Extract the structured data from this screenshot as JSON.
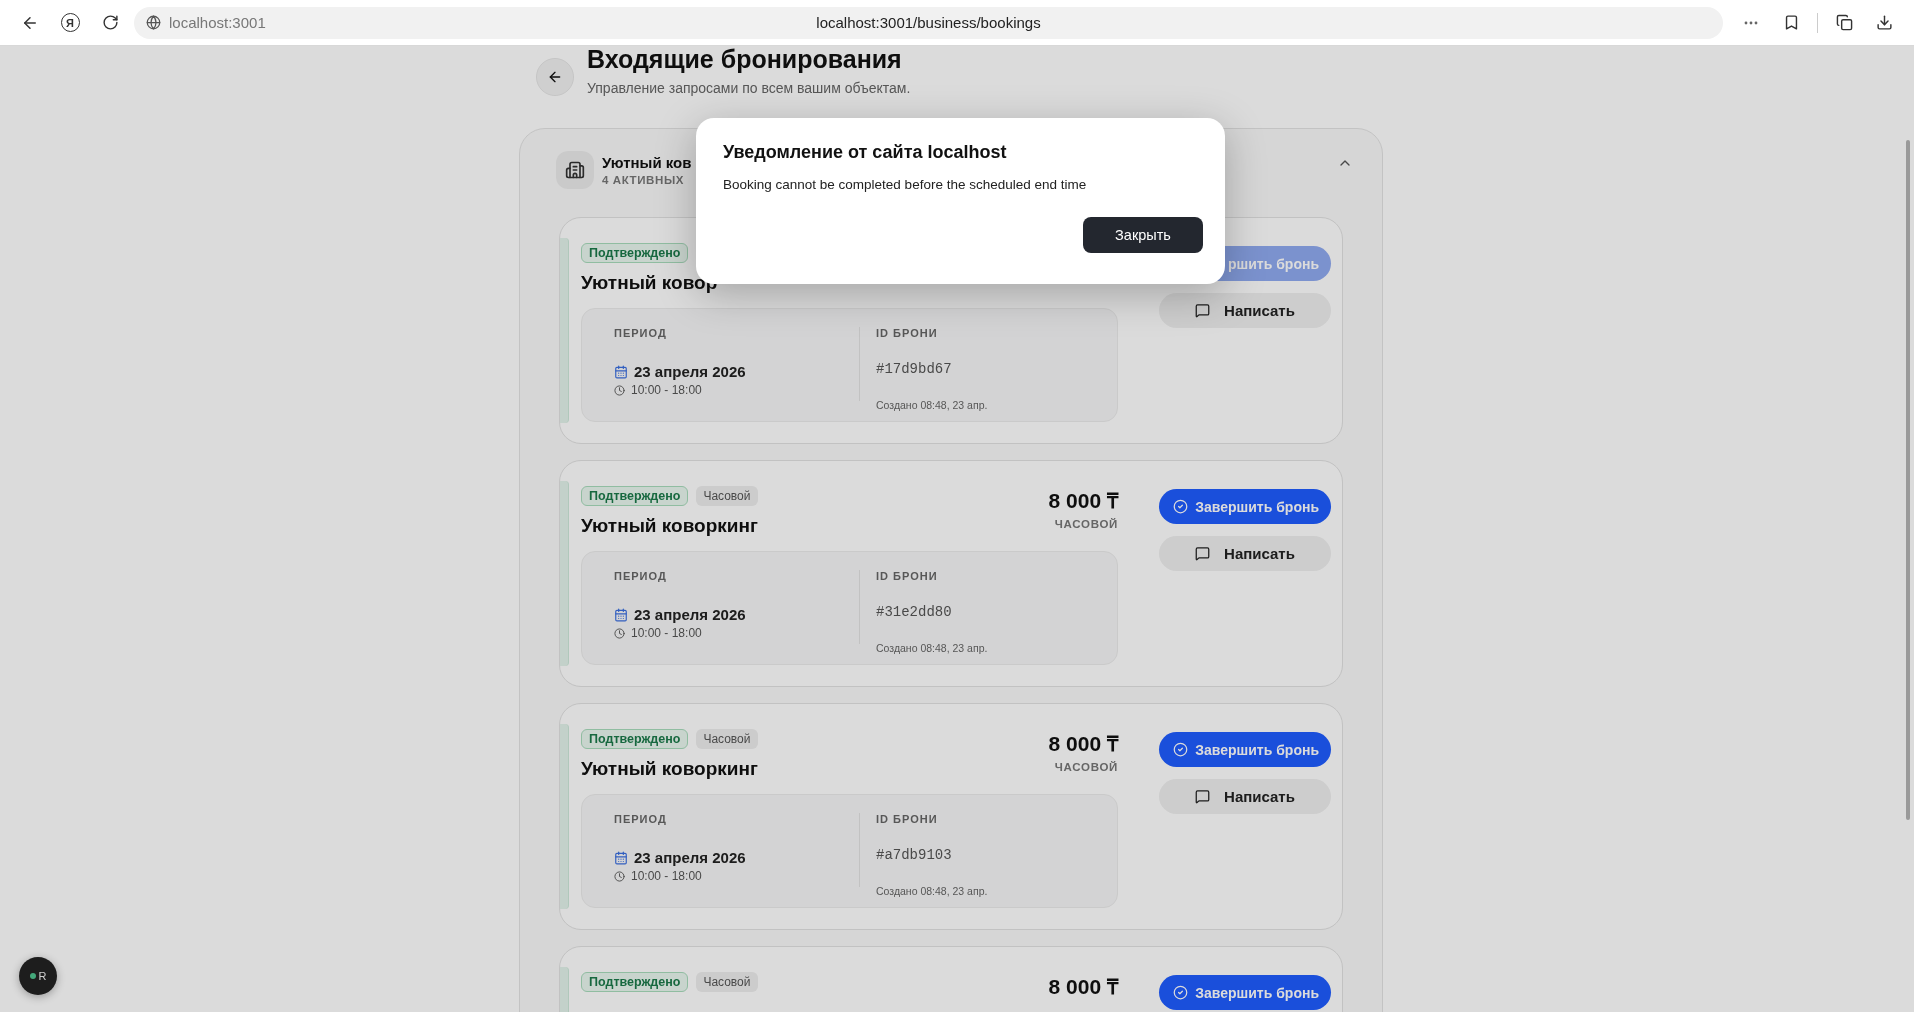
{
  "browser": {
    "logo": "Я",
    "site": "localhost:3001",
    "address": "localhost:3001/business/bookings"
  },
  "page": {
    "title": "Входящие бронирования",
    "subtitle": "Управление запросами по всем вашим объектам."
  },
  "property": {
    "name": "Уютный ков",
    "count": "4 АКТИВНЫХ",
    "expanded": true
  },
  "bookings": [
    {
      "status": "Подтверждено",
      "title": "Уютный ковор",
      "period_label": "ПЕРИОД",
      "date": "23 апреля 2026",
      "time": "10:00 - 18:00",
      "id_label": "ID БРОНИ",
      "id": "#17d9bd67",
      "created": "Создано 08:48, 23 апр.",
      "complete": {
        "label": "ршить бронь",
        "disabled": true
      },
      "message": "Написать"
    },
    {
      "status": "Подтверждено",
      "type": "Часовой",
      "title": "Уютный коворкинг",
      "price": "8 000 ₸",
      "price_unit": "ЧАСОВОЙ",
      "period_label": "ПЕРИОД",
      "date": "23 апреля 2026",
      "time": "10:00 - 18:00",
      "id_label": "ID БРОНИ",
      "id": "#31e2dd80",
      "created": "Создано 08:48, 23 апр.",
      "complete": {
        "label": "Завершить бронь",
        "disabled": false
      },
      "message": "Написать"
    },
    {
      "status": "Подтверждено",
      "type": "Часовой",
      "title": "Уютный коворкинг",
      "price": "8 000 ₸",
      "price_unit": "ЧАСОВОЙ",
      "period_label": "ПЕРИОД",
      "date": "23 апреля 2026",
      "time": "10:00 - 18:00",
      "id_label": "ID БРОНИ",
      "id": "#a7db9103",
      "created": "Создано 08:48, 23 апр.",
      "complete": {
        "label": "Завершить бронь",
        "disabled": false
      },
      "message": "Написать"
    },
    {
      "status": "Подтверждено",
      "type": "Часовой",
      "price": "8 000 ₸",
      "complete": {
        "label": "Завершить бронь",
        "disabled": false
      }
    }
  ],
  "assistant": {
    "label": "R"
  },
  "dialog": {
    "title": "Уведомление от сайта localhost",
    "message": "Booking cannot be completed before the scheduled end time",
    "button": "Закрыть"
  }
}
